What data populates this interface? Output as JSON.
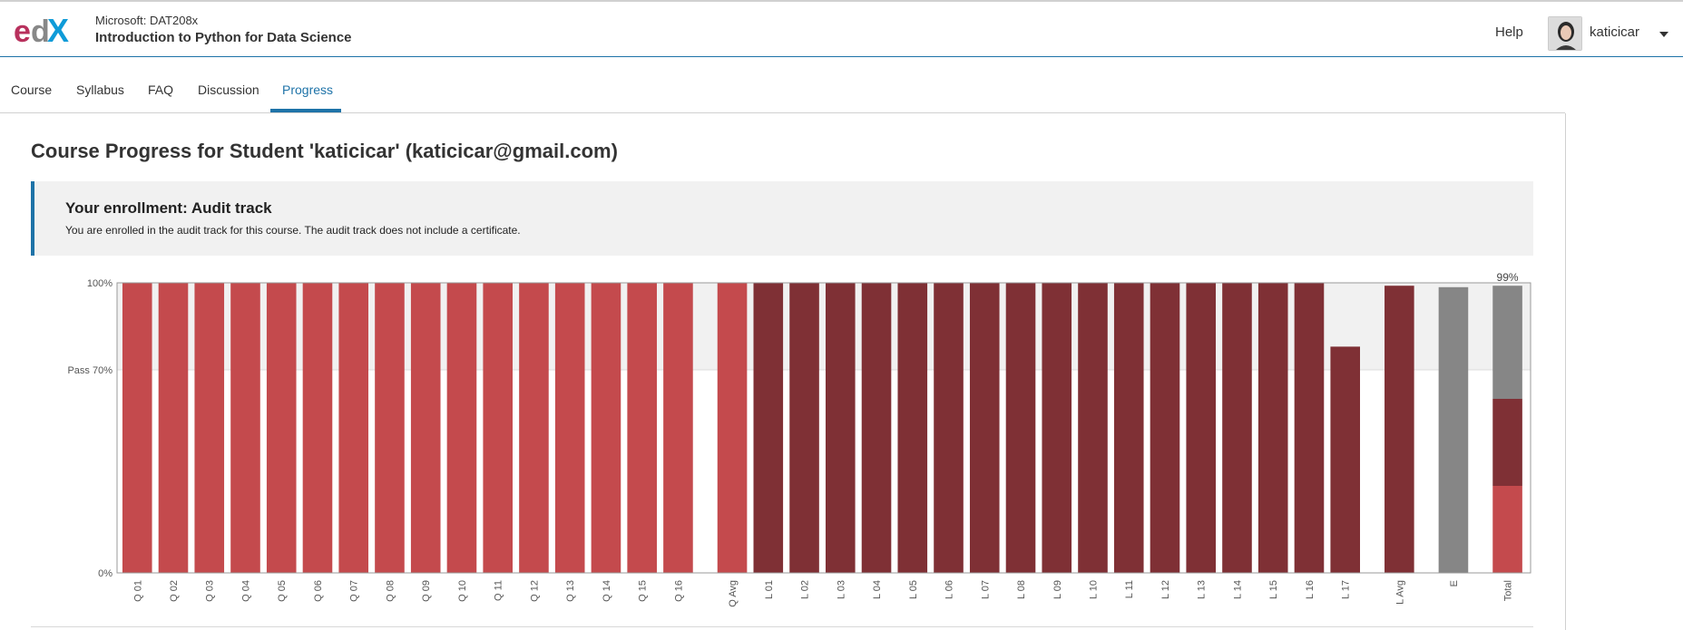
{
  "header": {
    "logo_text": "edX",
    "course_org": "Microsoft: DAT208x",
    "course_title": "Introduction to Python for Data Science",
    "help_label": "Help",
    "username": "katicicar"
  },
  "nav": {
    "tabs": [
      {
        "label": "Course",
        "active": false
      },
      {
        "label": "Syllabus",
        "active": false
      },
      {
        "label": "FAQ",
        "active": false
      },
      {
        "label": "Discussion",
        "active": false
      },
      {
        "label": "Progress",
        "active": true
      }
    ]
  },
  "page": {
    "title": "Course Progress for Student 'katicicar' (katicicar@gmail.com)"
  },
  "notice": {
    "title": "Your enrollment: Audit track",
    "text": "You are enrolled in the audit track for this course. The audit track does not include a certificate."
  },
  "colors": {
    "quiz": "#c44a4d",
    "lab": "#7f3035",
    "exam": "#868686",
    "accent": "#1e73a8",
    "pass_band": "#f1f1f1"
  },
  "chart_data": {
    "type": "bar",
    "y_ticks": [
      {
        "label": "100%",
        "value": 100
      },
      {
        "label": "Pass 70%",
        "value": 70
      },
      {
        "label": "0%",
        "value": 0
      }
    ],
    "ylim": [
      0,
      100
    ],
    "total_label": "99%",
    "categories": [
      "Q 01",
      "Q 02",
      "Q 03",
      "Q 04",
      "Q 05",
      "Q 06",
      "Q 07",
      "Q 08",
      "Q 09",
      "Q 10",
      "Q 11",
      "Q 12",
      "Q 13",
      "Q 14",
      "Q 15",
      "Q 16",
      "Q Avg",
      "L 01",
      "L 02",
      "L 03",
      "L 04",
      "L 05",
      "L 06",
      "L 07",
      "L 08",
      "L 09",
      "L 10",
      "L 11",
      "L 12",
      "L 13",
      "L 14",
      "L 15",
      "L 16",
      "L 17",
      "L Avg",
      "E",
      "Total"
    ],
    "values": [
      100,
      100,
      100,
      100,
      100,
      100,
      100,
      100,
      100,
      100,
      100,
      100,
      100,
      100,
      100,
      100,
      100,
      100,
      100,
      100,
      100,
      100,
      100,
      100,
      100,
      100,
      100,
      100,
      100,
      100,
      100,
      100,
      100,
      78,
      99,
      98.5,
      99
    ],
    "groups": [
      "quiz",
      "quiz",
      "quiz",
      "quiz",
      "quiz",
      "quiz",
      "quiz",
      "quiz",
      "quiz",
      "quiz",
      "quiz",
      "quiz",
      "quiz",
      "quiz",
      "quiz",
      "quiz",
      "quiz",
      "lab",
      "lab",
      "lab",
      "lab",
      "lab",
      "lab",
      "lab",
      "lab",
      "lab",
      "lab",
      "lab",
      "lab",
      "lab",
      "lab",
      "lab",
      "lab",
      "lab",
      "lab",
      "exam",
      "total"
    ],
    "total_stack": [
      {
        "group": "quiz",
        "value": 30
      },
      {
        "group": "lab",
        "value": 30
      },
      {
        "group": "exam",
        "value": 39
      }
    ]
  }
}
